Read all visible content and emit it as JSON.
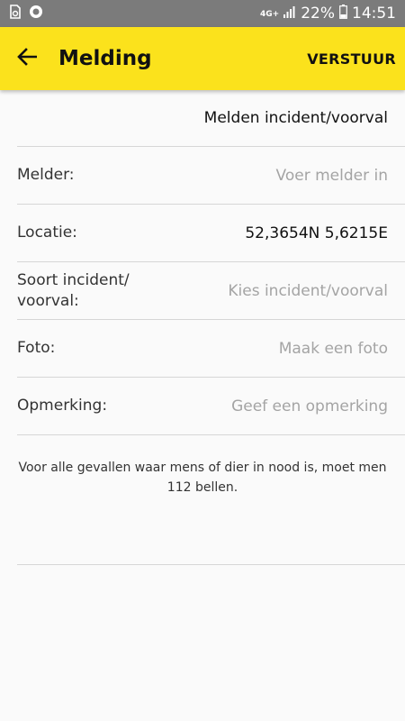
{
  "status_bar": {
    "network": "4G+",
    "battery": "22%",
    "time": "14:51",
    "icons": [
      "sim-card-icon",
      "vodafone-icon",
      "signal-icon",
      "battery-icon"
    ]
  },
  "app_bar": {
    "title": "Melding",
    "send_label": "VERSTUUR",
    "back_icon": "arrow-back-icon",
    "background": "#fbe21c"
  },
  "subtitle": "Melden incident/voorval",
  "form": {
    "reporter": {
      "label": "Melder:",
      "placeholder": "Voer melder in"
    },
    "location": {
      "label": "Locatie:",
      "value": "52,3654N 5,6215E"
    },
    "incident_type": {
      "label": "Soort incident/ voorval:",
      "placeholder": "Kies incident/voorval"
    },
    "photo": {
      "label": "Foto:",
      "placeholder": "Maak een foto"
    },
    "remark": {
      "label": "Opmerking:",
      "placeholder": "Geef een opmerking"
    }
  },
  "notice": "Voor alle gevallen waar mens of dier in nood is, moet men 112 bellen."
}
